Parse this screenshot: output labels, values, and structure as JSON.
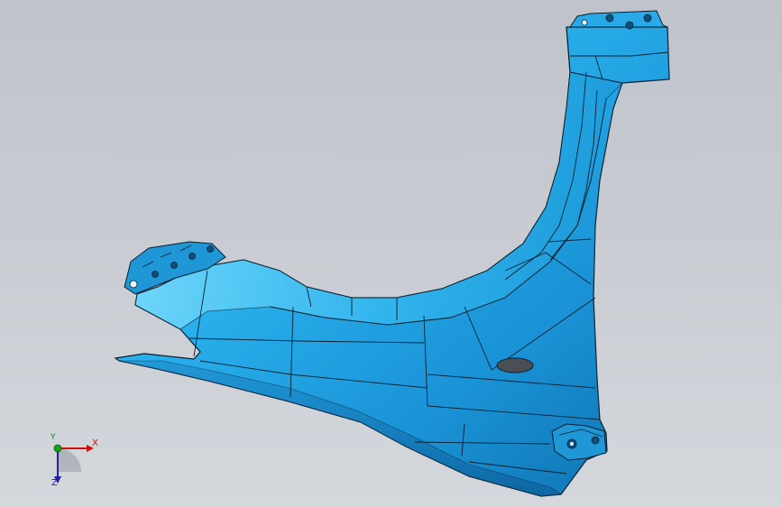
{
  "viewport": {
    "background_top": "#bfc3ca",
    "background_bottom": "#d4d7dc"
  },
  "model": {
    "part_color": "#2aa9e8",
    "part_highlight": "#5fd0ff",
    "part_shadow": "#0d6fae",
    "edge_color": "#0a2030",
    "hole_color": "#4a4f55"
  },
  "triad": {
    "x_label": "X",
    "y_label": "Y",
    "z_label": "Z",
    "x_color": "#d01010",
    "y_color": "#1aa01a",
    "z_color": "#2020b0"
  }
}
